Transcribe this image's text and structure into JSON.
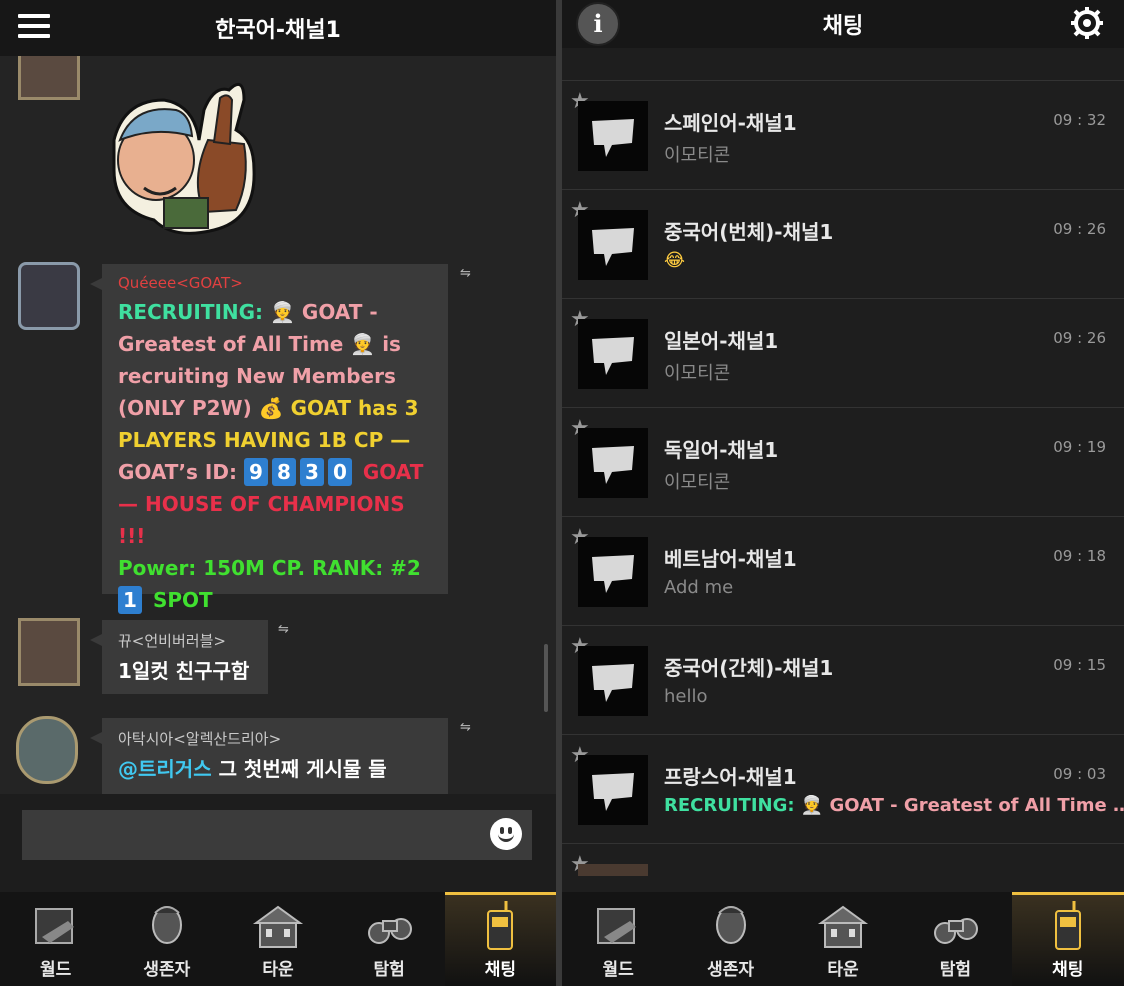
{
  "left": {
    "header": {
      "title": "한국어-채널1"
    },
    "messages": [
      {
        "sender": "Quéeee<GOAT>",
        "segments": [
          {
            "text": "RECRUITING: ",
            "color": "#3fe0a0"
          },
          {
            "text": "👳 ",
            "color": "#ffd060"
          },
          {
            "text": "GOAT - Greatest of All Time ",
            "color": "#f0a0a8"
          },
          {
            "text": "👳 ",
            "color": "#ffd060"
          },
          {
            "text": "is recruiting New Members (ONLY P2W) ",
            "color": "#f0a0a8"
          },
          {
            "text": "💰 ",
            "color": "#ffd060"
          },
          {
            "text": "GOAT has 3 PLAYERS HAVING 1B CP  — ",
            "color": "#f0d030"
          },
          {
            "text": "GOAT’s ID: ",
            "color": "#f0a0a8"
          }
        ],
        "id_digits": [
          "9",
          "8",
          "3",
          "0"
        ],
        "after_id": [
          {
            "text": " GOAT — HOUSE OF CHAMPIONS !!!",
            "color": "#e8304a"
          }
        ],
        "power_line": "Power: 150M CP.  RANK: #2",
        "spot_number": "1",
        "spot_text": "SPOT"
      },
      {
        "sender": "뀨<언비버러블>",
        "text": "1일컷 친구구함"
      },
      {
        "sender": "아탁시아<알렉산드리아>",
        "mention": "@트리거스",
        "text": " 그 첫번째 게시물 들"
      }
    ],
    "input": {
      "placeholder": ""
    },
    "tabs": [
      {
        "label": "월드",
        "icon": "revolver-map-icon"
      },
      {
        "label": "생존자",
        "icon": "survivor-face-icon"
      },
      {
        "label": "타운",
        "icon": "town-building-icon"
      },
      {
        "label": "탐험",
        "icon": "binoculars-icon"
      },
      {
        "label": "채팅",
        "icon": "walkie-talkie-icon",
        "active": true
      }
    ]
  },
  "right": {
    "header": {
      "title": "채팅"
    },
    "channels": [
      {
        "name": "스페인어-채널1",
        "time": "09 : 32",
        "last": "이모티콘",
        "last_color": "#8a8a8a"
      },
      {
        "name": "중국어(번체)-채널1",
        "time": "09 : 26",
        "last": "😂",
        "last_color": "#ffcc40"
      },
      {
        "name": "일본어-채널1",
        "time": "09 : 26",
        "last": "이모티콘",
        "last_color": "#8a8a8a"
      },
      {
        "name": "독일어-채널1",
        "time": "09 : 19",
        "last": "이모티콘",
        "last_color": "#8a8a8a"
      },
      {
        "name": "베트남어-채널1",
        "time": "09 : 18",
        "last": "Add me",
        "last_color": "#8a8a8a"
      },
      {
        "name": "중국어(간체)-채널1",
        "time": "09 : 15",
        "last": "hello",
        "last_color": "#8a8a8a"
      },
      {
        "name": "프랑스어-채널1",
        "time": "09 : 03",
        "last_prefix": "RECRUITING: ",
        "last": "👳 GOAT - Greatest of All Time …",
        "last_color": "#f0a0a8",
        "last_prefix_color": "#3fe0a0"
      }
    ],
    "tabs": [
      {
        "label": "월드",
        "icon": "revolver-map-icon"
      },
      {
        "label": "생존자",
        "icon": "survivor-face-icon"
      },
      {
        "label": "타운",
        "icon": "town-building-icon"
      },
      {
        "label": "탐험",
        "icon": "binoculars-icon"
      },
      {
        "label": "채팅",
        "icon": "walkie-talkie-icon",
        "active": true
      }
    ]
  },
  "colors": {
    "accent_gold": "#f0c040",
    "bubble": "#3a3a3a",
    "mention": "#40c8f0",
    "power_green": "#40e030",
    "id_key_blue": "#2e7fd0"
  }
}
